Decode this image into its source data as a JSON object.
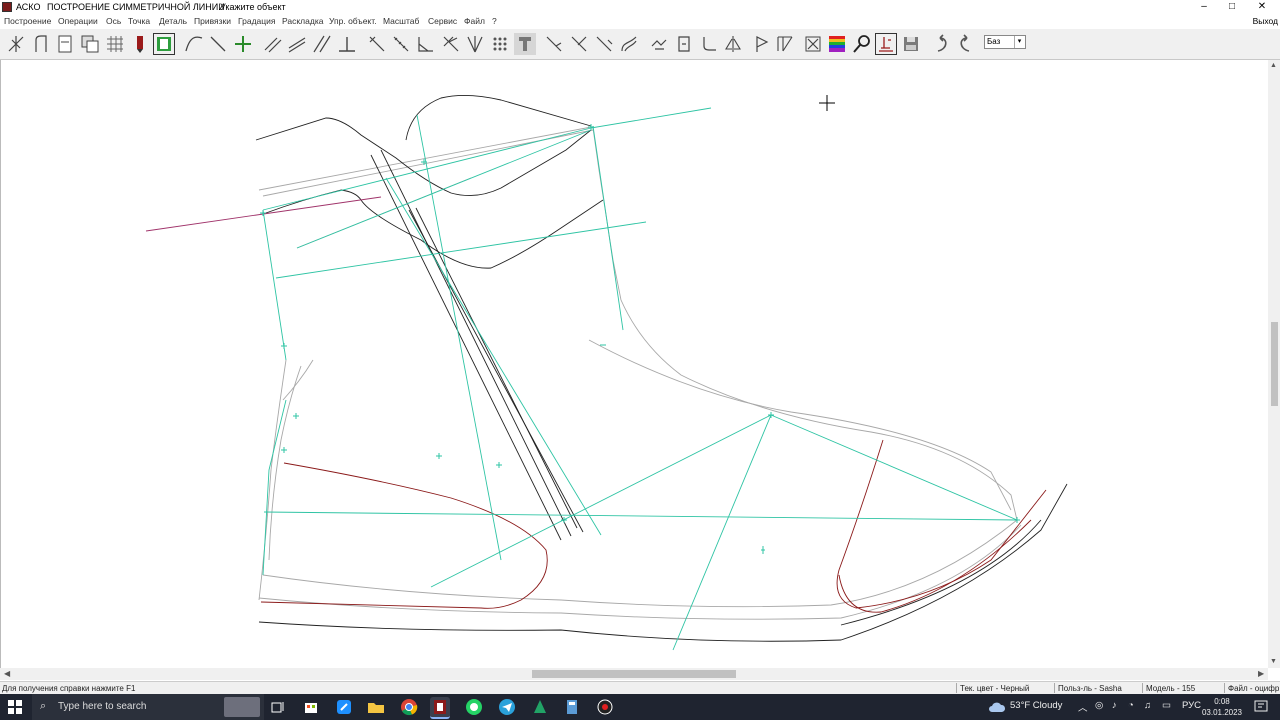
{
  "window": {
    "app_name": "АСКО",
    "mode_title": "ПОСТРОЕНИЕ СИММЕТРИЧНОЙ ЛИНИИ",
    "prompt": "Укажите объект",
    "minimize": "–",
    "maximize": "□",
    "close": "✕"
  },
  "menu": {
    "items": [
      "Построение",
      "Операции",
      "Ось",
      "Точка",
      "Деталь",
      "Привязки",
      "Градация",
      "Раскладка",
      "Упр. объект.",
      "Масштаб",
      "Сервис",
      "Файл",
      "?"
    ],
    "exit": "Выход"
  },
  "toolbar": {
    "layer_value": "Баз",
    "tools": [
      "auto-build-icon",
      "contour-icon",
      "page-icon",
      "copy-layers-icon",
      "grid-icon",
      "pen-red-icon",
      "select-frame-icon",
      "curve-icon",
      "line-icon",
      "add-point-icon",
      "parallel-line-icon",
      "double-line-icon",
      "offset-line-icon",
      "perpendicular-icon",
      "tangent-icon",
      "hatched-line-icon",
      "angle-icon",
      "bisector-icon",
      "fan-icon",
      "dots-icon",
      "stamp-icon",
      "segment-icon",
      "trim-icon",
      "knife-icon",
      "blend-icon",
      "link-icon",
      "notch-icon",
      "corner-icon",
      "mirror-icon",
      "flag-icon",
      "measure-icon",
      "delete-icon",
      "palette-icon",
      "zoom-icon",
      "measure-text-icon",
      "save-icon",
      "undo-icon",
      "redo-icon"
    ]
  },
  "status": {
    "help": "Для получения справки нажмите F1",
    "color": "Тек. цвет - Черный",
    "user": "Польз-ль - Sasha",
    "model": "Модель - 155",
    "file": "Файл - оцифр"
  },
  "taskbar": {
    "search_placeholder": "Type here to search",
    "weather": "53°F  Cloudy",
    "language": "РУС",
    "time": "0:08",
    "date": "03.01.2023"
  },
  "colors": {
    "cyan": "#2fc4a4",
    "dark_red": "#8b1a1a",
    "magenta": "#a0336a",
    "grey_line": "#a8a8a8"
  }
}
